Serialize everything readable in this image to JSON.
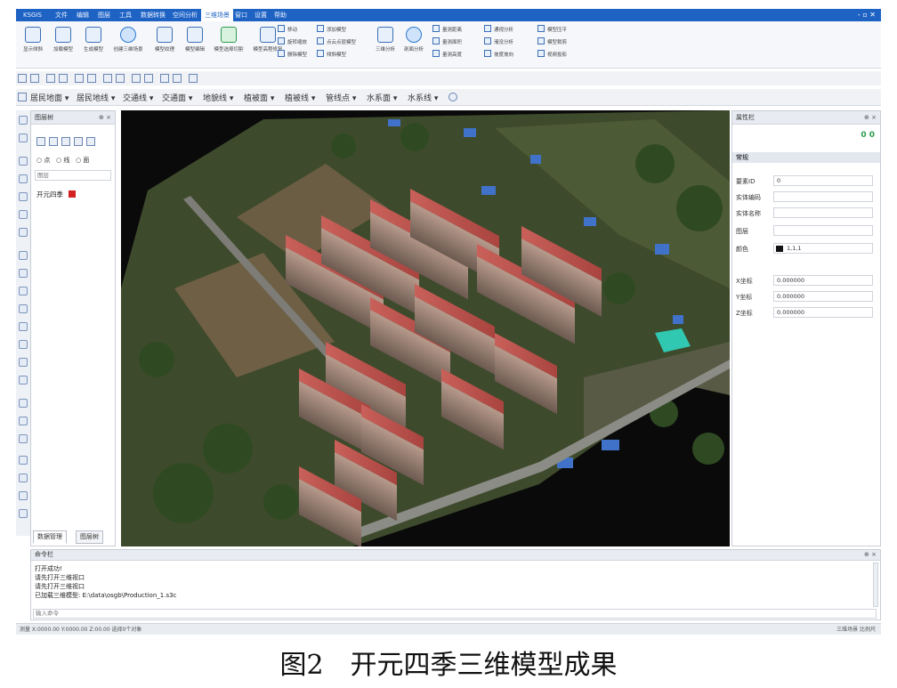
{
  "app": {
    "title": "KSGIS",
    "menus": [
      "文件",
      "编辑",
      "图层",
      "工具",
      "数据转换",
      "空间分析",
      "三维场景",
      "窗口",
      "设置",
      "帮助"
    ],
    "active_menu": "三维场景",
    "window_controls": "- ▫ ✕"
  },
  "ribbon": {
    "buttons": [
      "显示倾斜",
      "加载模型",
      "生成模型",
      "创建三维场景",
      "模型纹理",
      "模型编辑",
      "模型选择切割",
      "模型高程修复"
    ],
    "small_group1": [
      "移动",
      "旋转缩放",
      "删除模型"
    ],
    "small_group2": [
      "添加模型",
      "点云点层模型",
      "倾斜模型"
    ],
    "icon_buttons": [
      "三维分析",
      "剖面分析"
    ],
    "small_group3": [
      "量测距离",
      "量测面积",
      "量测高度"
    ],
    "small_group4": [
      "通视分析",
      "淹没分析",
      "坡度坡向"
    ],
    "small_group5": [
      "模型压平",
      "模型裁剪",
      "视频投影"
    ]
  },
  "toolbar": {
    "layers": [
      "居民地面 ▾",
      "居民地线 ▾",
      "交通线 ▾",
      "交通面 ▾",
      "地貌线 ▾",
      "植被面 ▾",
      "植被线 ▾",
      "管线点 ▾",
      "水系面 ▾",
      "水系线 ▾"
    ]
  },
  "left_panel": {
    "title": "图层树",
    "pin": "⊕ ×",
    "radios": [
      "点",
      "线",
      "面"
    ],
    "search_placeholder": "图层",
    "layer_name": "开元四季",
    "tabs": [
      "数据管理",
      "图层树"
    ]
  },
  "right_panel": {
    "title": "属性栏",
    "pin": "⊕ ×",
    "indicators": "0 0",
    "section": "常规",
    "props": [
      {
        "label": "要素ID",
        "value": "0"
      },
      {
        "label": "实体编码",
        "value": ""
      },
      {
        "label": "实体名称",
        "value": ""
      },
      {
        "label": "图层",
        "value": ""
      },
      {
        "label": "颜色",
        "value": "1,1,1"
      },
      {
        "label": "X坐标",
        "value": "0.000000"
      },
      {
        "label": "Y坐标",
        "value": "0.000000"
      },
      {
        "label": "Z坐标",
        "value": "0.000000"
      }
    ]
  },
  "command_panel": {
    "title": "命令栏",
    "pin": "⊕ ×",
    "lines": [
      "打开成功!",
      "请先打开三维视口",
      "请先打开三维视口",
      "已加载三维模型: E:\\data\\osgb\\Production_1.s3c"
    ],
    "input_placeholder": "输入命令"
  },
  "status": {
    "left": "测量 X:0000.00 Y:0000.00 Z:00.00 选择0个对象",
    "right": "三维场景  比例尺"
  },
  "caption": "图2　开元四季三维模型成果",
  "colors": {
    "title_bar": "#1e63c4",
    "layer_swatch": "#d32020"
  }
}
